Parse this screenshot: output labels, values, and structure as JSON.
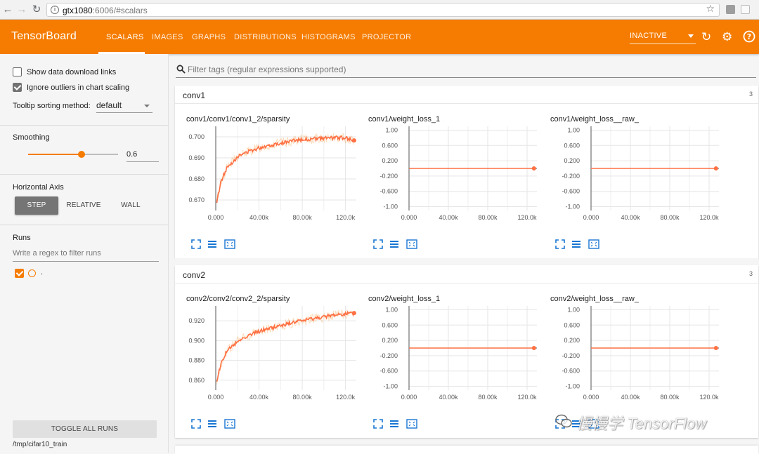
{
  "browser": {
    "url_host": "gtx1080",
    "url_path": ":6006/#scalars"
  },
  "header": {
    "brand": "TensorBoard",
    "tabs": [
      {
        "label": "SCALARS",
        "active": true
      },
      {
        "label": "IMAGES",
        "active": false
      },
      {
        "label": "GRAPHS",
        "active": false
      },
      {
        "label": "DISTRIBUTIONS",
        "active": false
      },
      {
        "label": "HISTOGRAMS",
        "active": false
      },
      {
        "label": "PROJECTOR",
        "active": false
      }
    ],
    "status_select": "INACTIVE",
    "accent_color": "#f57c00"
  },
  "sidebar": {
    "show_download_label": "Show data download links",
    "show_download_checked": false,
    "ignore_outliers_label": "Ignore outliers in chart scaling",
    "ignore_outliers_checked": true,
    "tooltip_label": "Tooltip sorting method:",
    "tooltip_value": "default",
    "smoothing_title": "Smoothing",
    "smoothing_value": "0.6",
    "smoothing_fraction": 0.6,
    "haxis_title": "Horizontal Axis",
    "haxis_options": [
      "STEP",
      "RELATIVE",
      "WALL"
    ],
    "haxis_selected": "STEP",
    "runs_title": "Runs",
    "runs_placeholder": "Write a regex to filter runs",
    "run_name": ".",
    "run_color": "#f57c00",
    "toggle_all": "TOGGLE ALL RUNS",
    "logdir": "/tmp/cifar10_train"
  },
  "filter": {
    "placeholder": "Filter tags (regular expressions supported)"
  },
  "groups": [
    {
      "name": "conv1",
      "count": "3"
    },
    {
      "name": "conv2",
      "count": "3"
    }
  ],
  "watermark": "慢慢学 TensorFlow",
  "chart_data": [
    {
      "type": "line",
      "title": "conv1/conv1/conv1_2/sparsity",
      "x_ticks": [
        "0.000",
        "40.00k",
        "80.00k",
        "120.0k"
      ],
      "y_ticks": [
        "0.670",
        "0.680",
        "0.690",
        "0.700"
      ],
      "xlim": [
        0,
        130000
      ],
      "ylim": [
        0.665,
        0.705
      ],
      "series": [
        {
          "x": [
            0,
            2000,
            5000,
            10000,
            20000,
            30000,
            45000,
            60000,
            75000,
            90000,
            105000,
            120000,
            130000
          ],
          "y": [
            0.665,
            0.672,
            0.679,
            0.685,
            0.6905,
            0.693,
            0.6955,
            0.697,
            0.6985,
            0.699,
            0.6995,
            0.6995,
            0.698
          ]
        }
      ],
      "grid": true
    },
    {
      "type": "line",
      "title": "conv1/weight_loss_1",
      "x_ticks": [
        "0.000",
        "40.00k",
        "80.00k",
        "120.0k"
      ],
      "y_ticks": [
        "1.00",
        "0.600",
        "0.200",
        "-0.200",
        "-0.600",
        "-1.00"
      ],
      "xlim": [
        0,
        130000
      ],
      "ylim": [
        -1.1,
        1.1
      ],
      "series": [
        {
          "x": [
            0,
            127000
          ],
          "y": [
            0,
            0
          ]
        }
      ],
      "grid": true
    },
    {
      "type": "line",
      "title": "conv1/weight_loss__raw_",
      "x_ticks": [
        "0.000",
        "40.00k",
        "80.00k",
        "120.0k"
      ],
      "y_ticks": [
        "1.00",
        "0.600",
        "0.200",
        "-0.200",
        "-0.600",
        "-1.00"
      ],
      "xlim": [
        0,
        130000
      ],
      "ylim": [
        -1.1,
        1.1
      ],
      "series": [
        {
          "x": [
            0,
            127000
          ],
          "y": [
            0,
            0
          ]
        }
      ],
      "grid": true
    },
    {
      "type": "line",
      "title": "conv2/conv2/conv2_2/sparsity",
      "x_ticks": [
        "0.000",
        "40.00k",
        "80.00k",
        "120.0k"
      ],
      "y_ticks": [
        "0.860",
        "0.880",
        "0.900",
        "0.920"
      ],
      "xlim": [
        0,
        130000
      ],
      "ylim": [
        0.85,
        0.935
      ],
      "series": [
        {
          "x": [
            0,
            2000,
            5000,
            10000,
            20000,
            30000,
            45000,
            60000,
            75000,
            90000,
            105000,
            120000,
            130000
          ],
          "y": [
            0.85,
            0.865,
            0.877,
            0.889,
            0.899,
            0.905,
            0.911,
            0.915,
            0.919,
            0.922,
            0.925,
            0.927,
            0.928
          ]
        }
      ],
      "grid": true
    },
    {
      "type": "line",
      "title": "conv2/weight_loss_1",
      "x_ticks": [
        "0.000",
        "40.00k",
        "80.00k",
        "120.0k"
      ],
      "y_ticks": [
        "1.00",
        "0.600",
        "0.200",
        "-0.200",
        "-0.600",
        "-1.00"
      ],
      "xlim": [
        0,
        130000
      ],
      "ylim": [
        -1.1,
        1.1
      ],
      "series": [
        {
          "x": [
            0,
            127000
          ],
          "y": [
            0,
            0
          ]
        }
      ],
      "grid": true
    },
    {
      "type": "line",
      "title": "conv2/weight_loss__raw_",
      "x_ticks": [
        "0.000",
        "40.00k",
        "80.00k",
        "120.0k"
      ],
      "y_ticks": [
        "1.00",
        "0.600",
        "0.200",
        "-0.200",
        "-0.600",
        "-1.00"
      ],
      "xlim": [
        0,
        130000
      ],
      "ylim": [
        -1.1,
        1.1
      ],
      "series": [
        {
          "x": [
            0,
            127000
          ],
          "y": [
            0,
            0
          ]
        }
      ],
      "grid": true
    }
  ]
}
